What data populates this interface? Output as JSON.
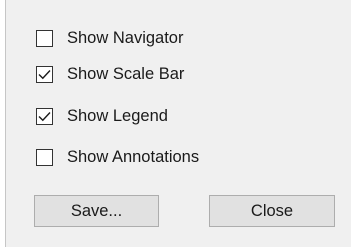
{
  "options": [
    {
      "label": "Show Navigator",
      "checked": false
    },
    {
      "label": "Show Scale Bar",
      "checked": true
    },
    {
      "label": "Show Legend",
      "checked": true
    },
    {
      "label": "Show Annotations",
      "checked": false
    }
  ],
  "buttons": {
    "save_label": "Save...",
    "close_label": "Close"
  },
  "colors": {
    "dialog_background": "#f0f0f0",
    "button_background": "#e1e1e1",
    "button_border": "#adadad",
    "checkbox_border": "#333333"
  },
  "icons": {
    "check": "checkmark-icon"
  }
}
